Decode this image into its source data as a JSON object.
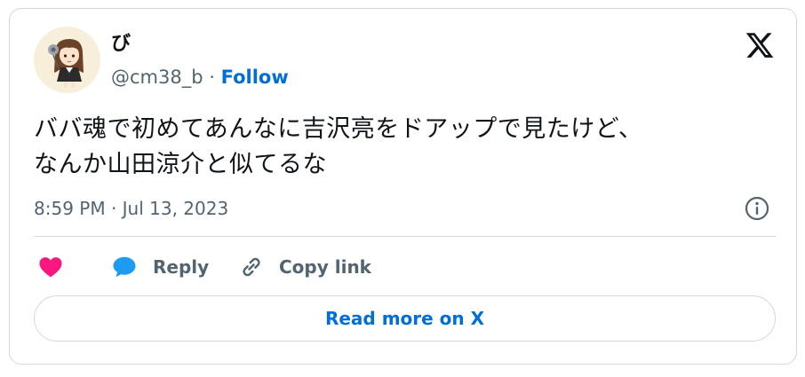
{
  "user": {
    "display_name": "び",
    "handle": "@cm38_b",
    "separator": " · ",
    "follow_label": "Follow",
    "avatar_icon": "anime-girl-avatar"
  },
  "brand": {
    "logo_icon": "x-logo-icon"
  },
  "tweet": {
    "line1": "ババ魂で初めてあんなに吉沢亮をドアップで見たけど、",
    "line2": "なんか山田涼介と似てるな",
    "timestamp": "8:59 PM · Jul 13, 2023"
  },
  "actions": {
    "like_icon": "heart-icon",
    "reply_label": "Reply",
    "copy_label": "Copy link"
  },
  "read_more_label": "Read more on X",
  "colors": {
    "accent": "#006fd6",
    "like": "#f91880",
    "reply_icon": "#1d9bf0",
    "muted": "#536471",
    "border": "#cfd9de"
  }
}
